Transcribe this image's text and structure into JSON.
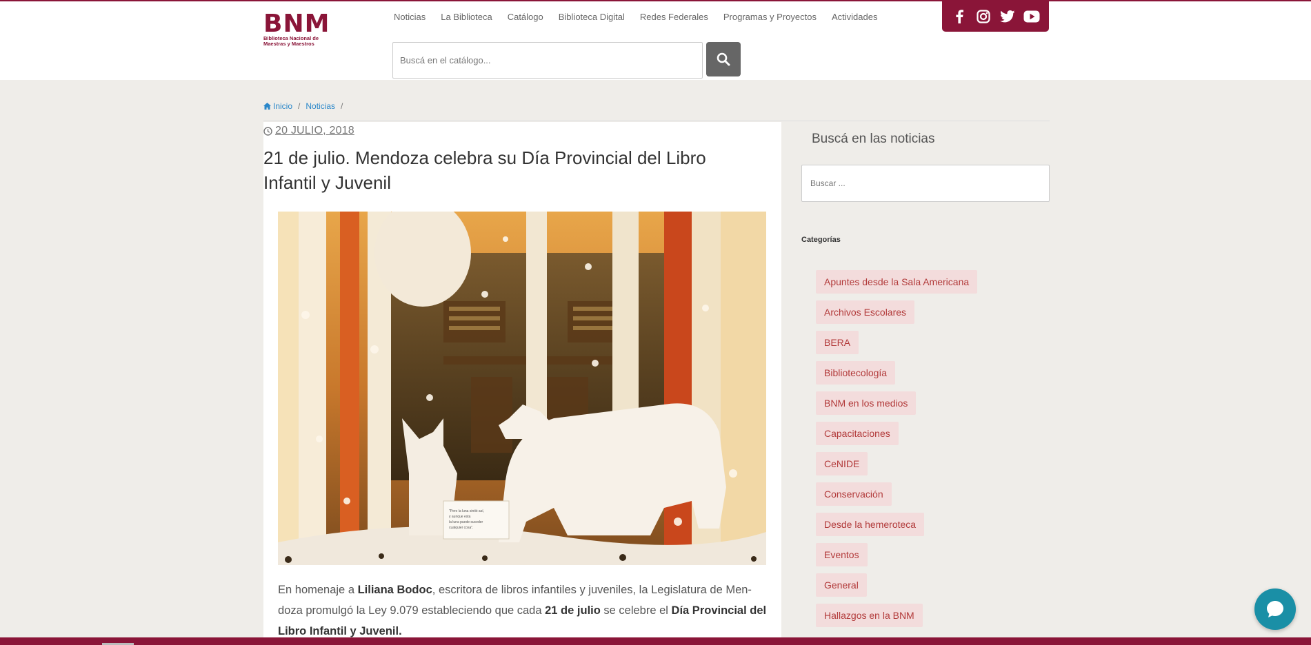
{
  "brand": {
    "logo_mark": "BNM",
    "logo_sub": "Biblioteca Nacional de Maestras y Maestros",
    "color": "#8a1538"
  },
  "nav": {
    "items": [
      "Noticias",
      "La Biblioteca",
      "Catálogo",
      "Biblioteca Digital",
      "Redes Federales",
      "Programas y Proyectos",
      "Actividades"
    ]
  },
  "social": {
    "icons": [
      "facebook-icon",
      "instagram-icon",
      "twitter-icon",
      "youtube-icon"
    ]
  },
  "catalog_search": {
    "placeholder": "Buscá en el catálogo..."
  },
  "breadcrumb": {
    "home": "Inicio",
    "section": "Noticias",
    "sep": "/"
  },
  "post": {
    "date": "20 JULIO, 2018",
    "title": "21 de julio. Mendoza celebra su Día Provincial del Libro Infantil y Juvenil",
    "image_caption_text": "\"Pero la luna sintió así, y aunque esta la luna puede suceder cualquier cosa\".",
    "body": {
      "t1": "En homenaje a ",
      "b1": "Liliana Bodoc",
      "t2": ", escritora de libros infantiles y juveniles, la Legislatura de Men-doza promulgó la Ley 9.079 estableciendo que cada ",
      "b2": "21 de julio",
      "t3": " se celebre el ",
      "b3": "Día Provincial del Libro Infantil y Juvenil."
    }
  },
  "sidebar": {
    "title": "Buscá en las noticias",
    "search_placeholder": "Buscar ...",
    "categories_title": "Categorías",
    "categories": [
      "Apuntes desde la Sala Americana",
      "Archivos Escolares",
      "BERA",
      "Bibliotecología",
      "BNM en los medios",
      "Capacitaciones",
      "CeNIDE",
      "Conservación",
      "Desde la hemeroteca",
      "Eventos",
      "General",
      "Hallazgos en la BNM"
    ]
  },
  "chat": {
    "icon": "chat-icon",
    "color": "#1a8fa6"
  }
}
